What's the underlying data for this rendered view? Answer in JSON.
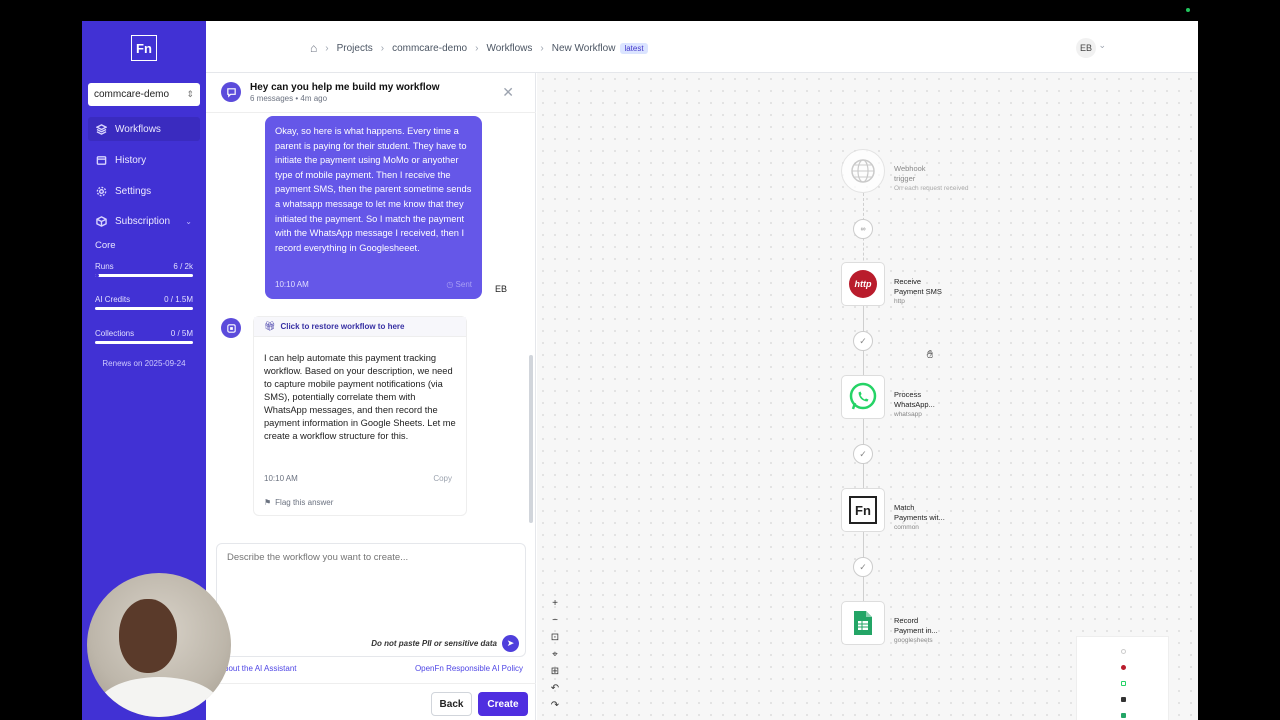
{
  "app": {
    "logo_text": "Fn"
  },
  "sidebar": {
    "project": "commcare-demo",
    "nav": [
      {
        "label": "Workflows"
      },
      {
        "label": "History"
      },
      {
        "label": "Settings"
      },
      {
        "label": "Subscription"
      }
    ],
    "core_label": "Core",
    "usage": [
      {
        "label": "Runs",
        "value": "6 / 2k",
        "fraction": 0.003
      },
      {
        "label": "AI Credits",
        "value": "0 / 1.5M",
        "fraction": 0
      },
      {
        "label": "Collections",
        "value": "0 / 5M",
        "fraction": 0
      }
    ],
    "renews": "Renews on 2025-09-24"
  },
  "header": {
    "breadcrumbs": [
      "Projects",
      "commcare-demo",
      "Workflows",
      "New Workflow"
    ],
    "badge": "latest",
    "avatar": "EB"
  },
  "chat": {
    "title": "Hey can you help me build my workflow",
    "subtitle": "6 messages • 4m ago",
    "user_message": "Okay, so here is what happens. Every time a parent is paying for their student. They have to initiate the payment using MoMo or anyother type of mobile payment. Then I receive the payment SMS, then the parent sometime sends a whatsapp message to let me know that they initiated the payment. So I match the payment with the WhatsApp message I received, then I record everything in Googlesheeet.",
    "user_time": "10:10 AM",
    "user_status": "Sent",
    "user_initials": "EB",
    "restore_label": "Click to restore workflow to here",
    "bot_message": "I can help automate this payment tracking workflow. Based on your description, we need to capture mobile payment notifications (via SMS), potentially correlate them with WhatsApp messages, and then record the payment information in Google Sheets. Let me create a workflow structure for this.",
    "bot_time": "10:10 AM",
    "copy_label": "Copy",
    "flag_label": "Flag this answer",
    "input_placeholder": "Describe the workflow you want to create...",
    "pii_notice": "Do not paste PII or sensitive data",
    "link_about": "bout the AI Assistant",
    "link_policy": "OpenFn Responsible AI Policy",
    "back_label": "Back",
    "create_label": "Create"
  },
  "workflow": {
    "nodes": [
      {
        "title1": "Webhook",
        "title2": "trigger",
        "sub": "On each request received",
        "icon": "globe-icon"
      },
      {
        "title1": "Receive",
        "title2": "Payment SMS",
        "sub": "http",
        "icon": "http-icon",
        "icon_text": "http"
      },
      {
        "title1": "Process",
        "title2": "WhatsApp...",
        "sub": "whatsapp",
        "icon": "whatsapp-icon"
      },
      {
        "title1": "Match",
        "title2": "Payments wit...",
        "sub": "common",
        "icon": "fn-icon",
        "icon_text": "Fn"
      },
      {
        "title1": "Record",
        "title2": "Payment in...",
        "sub": "googlesheets",
        "icon": "sheets-icon"
      }
    ],
    "controls": [
      "+",
      "−",
      "⊡",
      "⌖",
      "⊞",
      "↶",
      "↷"
    ]
  },
  "colors": {
    "accent": "#4131d4",
    "user_bubble": "#6557e8",
    "create": "#4f2ee0"
  }
}
